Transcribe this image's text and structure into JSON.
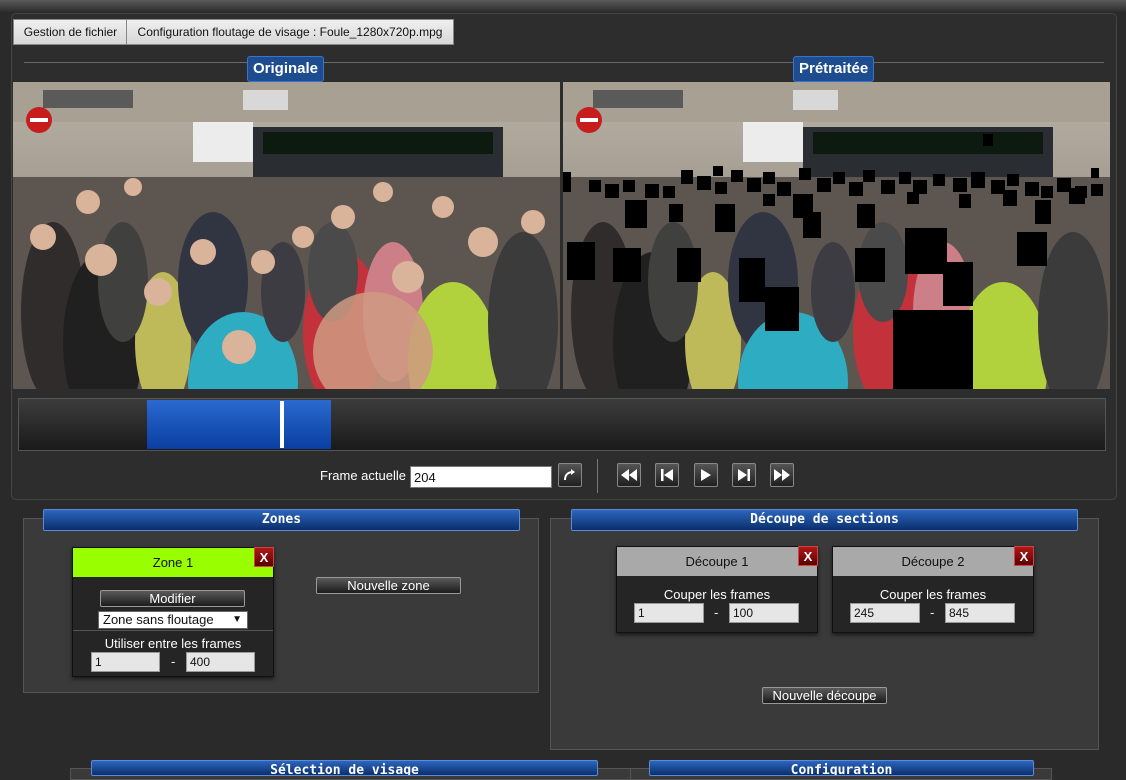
{
  "tabs": [
    {
      "label": "Gestion de fichier"
    },
    {
      "label": "Configuration floutage de visage : Foule_1280x720p.mpg"
    }
  ],
  "video": {
    "original_label": "Originale",
    "processed_label": "Prétraitée"
  },
  "frame": {
    "label": "Frame actuelle",
    "value": "204"
  },
  "zones": {
    "title": "Zones",
    "new_zone_label": "Nouvelle zone",
    "zone": {
      "title": "Zone 1",
      "close_label": "X",
      "modify_label": "Modifier",
      "mode_value": "Zone sans floutage",
      "use_label": "Utiliser entre les frames",
      "from": "1",
      "dash": "-",
      "to": "400",
      "accent": "#99ff00"
    }
  },
  "sections": {
    "title": "Découpe de sections",
    "new_cut_label": "Nouvelle découpe",
    "cuts": [
      {
        "title": "Découpe 1",
        "close_label": "X",
        "cut_label": "Couper les frames",
        "from": "1",
        "dash": "-",
        "to": "100"
      },
      {
        "title": "Découpe 2",
        "close_label": "X",
        "cut_label": "Couper les frames",
        "from": "245",
        "dash": "-",
        "to": "845"
      }
    ]
  },
  "bottom": {
    "face_selection_title": "Sélection de visage",
    "config_title": "Configuration"
  }
}
